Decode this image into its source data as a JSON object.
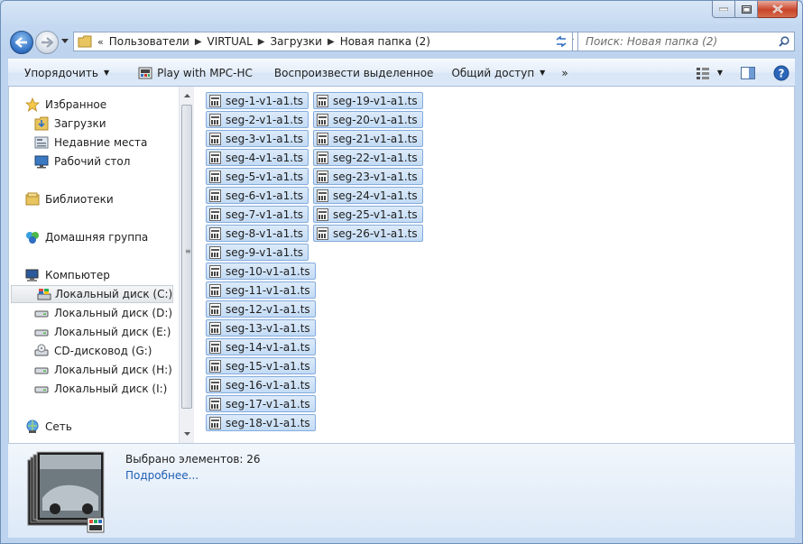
{
  "window": {
    "caption_buttons": [
      "minimize",
      "maximize",
      "close"
    ]
  },
  "address": {
    "overflow": "«",
    "crumbs": [
      "Пользователи",
      "VIRTUAL",
      "Загрузки",
      "Новая папка (2)"
    ]
  },
  "search": {
    "placeholder": "Поиск: Новая папка (2)"
  },
  "toolbar": {
    "organize": "Упорядочить",
    "play": "Play with MPC-HC",
    "play_selected": "Воспроизвести выделенное",
    "share": "Общий доступ",
    "more": "»"
  },
  "nav": {
    "favorites": "Избранное",
    "downloads": "Загрузки",
    "recent": "Недавние места",
    "desktop": "Рабочий стол",
    "libraries": "Библиотеки",
    "homegroup": "Домашняя группа",
    "computer": "Компьютер",
    "drive_c": "Локальный диск (C:)",
    "drive_d": "Локальный диск (D:)",
    "drive_e": "Локальный диск (E:)",
    "drive_g": "CD-дисковод (G:)",
    "drive_h": "Локальный диск (H:)",
    "drive_i": "Локальный диск (I:)",
    "network": "Сеть"
  },
  "files": [
    "seg-1-v1-a1.ts",
    "seg-2-v1-a1.ts",
    "seg-3-v1-a1.ts",
    "seg-4-v1-a1.ts",
    "seg-5-v1-a1.ts",
    "seg-6-v1-a1.ts",
    "seg-7-v1-a1.ts",
    "seg-8-v1-a1.ts",
    "seg-9-v1-a1.ts",
    "seg-10-v1-a1.ts",
    "seg-11-v1-a1.ts",
    "seg-12-v1-a1.ts",
    "seg-13-v1-a1.ts",
    "seg-14-v1-a1.ts",
    "seg-15-v1-a1.ts",
    "seg-16-v1-a1.ts",
    "seg-17-v1-a1.ts",
    "seg-18-v1-a1.ts",
    "seg-19-v1-a1.ts",
    "seg-20-v1-a1.ts",
    "seg-21-v1-a1.ts",
    "seg-22-v1-a1.ts",
    "seg-23-v1-a1.ts",
    "seg-24-v1-a1.ts",
    "seg-25-v1-a1.ts",
    "seg-26-v1-a1.ts"
  ],
  "details": {
    "selected": "Выбрано элементов: 26",
    "more": "Подробнее..."
  }
}
